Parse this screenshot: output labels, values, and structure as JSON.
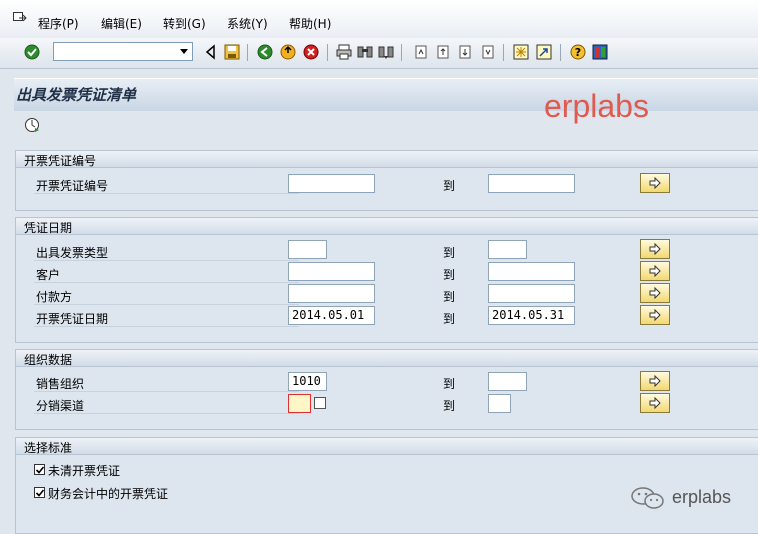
{
  "menu": {
    "items": [
      "程序(P)",
      "编辑(E)",
      "转到(G)",
      "系统(Y)",
      "帮助(H)"
    ]
  },
  "toolbar": {
    "command_field_value": "",
    "icons": [
      "check-icon",
      "back-icon",
      "save-icon",
      "nav-back-icon",
      "exit-icon",
      "cancel-icon",
      "print-icon",
      "find-icon",
      "find-next-icon",
      "first-page-icon",
      "prev-page-icon",
      "next-page-icon",
      "last-page-icon",
      "new-session-icon",
      "shortcut-icon",
      "help-icon",
      "layout-icon"
    ]
  },
  "title": "出具发票凭证清单",
  "watermark": "erplabs",
  "to_label": "到",
  "sections": [
    {
      "title": "开票凭证编号",
      "rows": [
        {
          "label": "开票凭证编号",
          "from": "",
          "to": ""
        }
      ]
    },
    {
      "title": "凭证日期",
      "rows": [
        {
          "label": "出具发票类型",
          "from": "",
          "to": ""
        },
        {
          "label": "客户",
          "from": "",
          "to": ""
        },
        {
          "label": "付款方",
          "from": "",
          "to": ""
        },
        {
          "label": "开票凭证日期",
          "from": "2014.05.01",
          "to": "2014.05.31"
        }
      ]
    },
    {
      "title": "组织数据",
      "rows": [
        {
          "label": "销售组织",
          "from": "1010",
          "to": ""
        },
        {
          "label": "分销渠道",
          "from": "",
          "to": ""
        }
      ]
    },
    {
      "title": "选择标准",
      "checkboxes": [
        {
          "label": "未清开票凭证",
          "checked": true
        },
        {
          "label": "财务会计中的开票凭证",
          "checked": true
        }
      ]
    }
  ],
  "footer_brand": "erplabs"
}
